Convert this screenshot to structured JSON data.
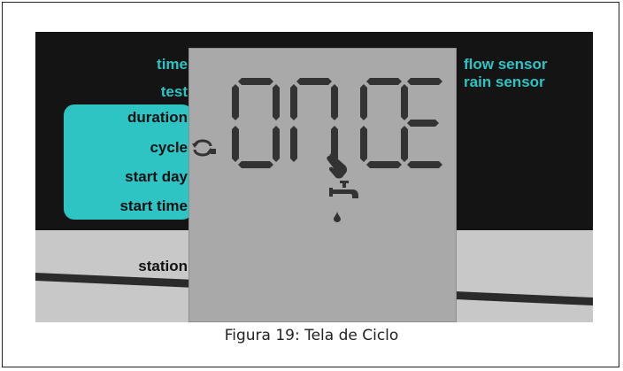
{
  "display": {
    "left_labels": [
      "time",
      "test",
      "duration",
      "cycle",
      "start day",
      "start time"
    ],
    "right_labels": [
      "flow sensor",
      "rain sensor"
    ],
    "station_label": "station",
    "lcd_text": "ONCE",
    "icons": [
      "cycle-arrows-icon",
      "hand-pointer-icon",
      "faucet-icon",
      "water-drop-icon"
    ],
    "colors": {
      "accent_teal": "#2ec4c4",
      "panel_dark": "#141414",
      "lcd_gray": "#a9a9a9",
      "segment_dark": "#333333"
    }
  },
  "caption": "Figura 19: Tela de Ciclo"
}
